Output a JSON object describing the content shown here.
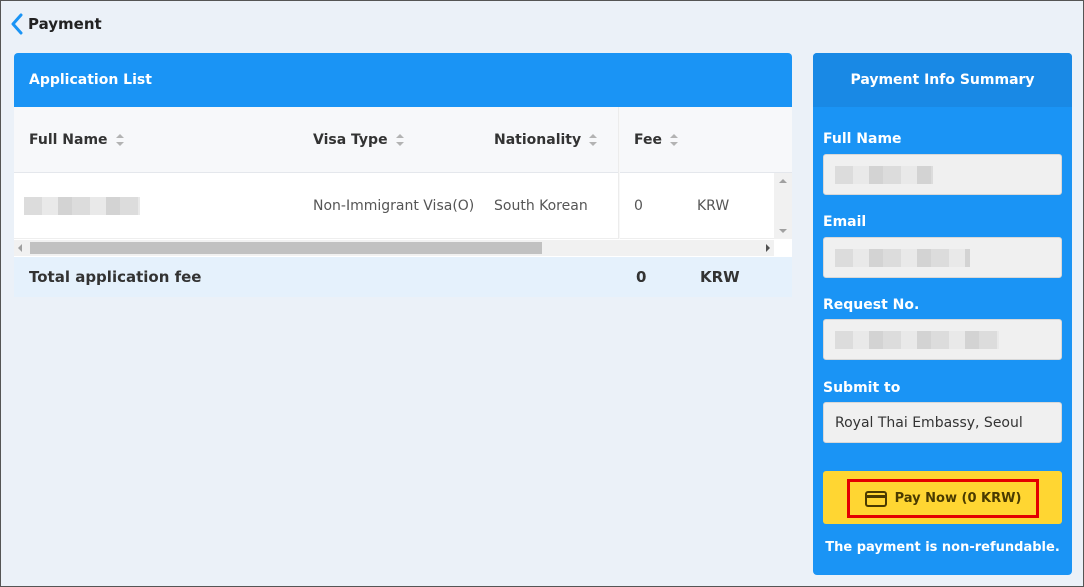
{
  "header": {
    "title": "Payment",
    "back_icon": "chevron-left-icon"
  },
  "application_list": {
    "title": "Application List",
    "columns": [
      "Full Name",
      "Visa Type",
      "Nationality",
      "Fee"
    ],
    "rows": [
      {
        "full_name": "",
        "visa_type": "Non-Immigrant Visa(O)",
        "nationality": "South Korean",
        "fee": "0",
        "currency": "KRW"
      }
    ],
    "total": {
      "label": "Total application fee",
      "amount": "0",
      "currency": "KRW"
    }
  },
  "summary": {
    "title": "Payment Info Summary",
    "fields": [
      {
        "label": "Full Name",
        "value": ""
      },
      {
        "label": "Email",
        "value": ""
      },
      {
        "label": "Request No.",
        "value": ""
      },
      {
        "label": "Submit to",
        "value": "Royal Thai Embassy, Seoul"
      }
    ],
    "pay_button": "Pay Now (0 KRW)",
    "pay_icon": "credit-card-icon",
    "note": "The payment is non-refundable."
  },
  "colors": {
    "primary": "#1a94f5",
    "pay_button_bg": "#ffd632",
    "highlight_border": "#e30000"
  }
}
